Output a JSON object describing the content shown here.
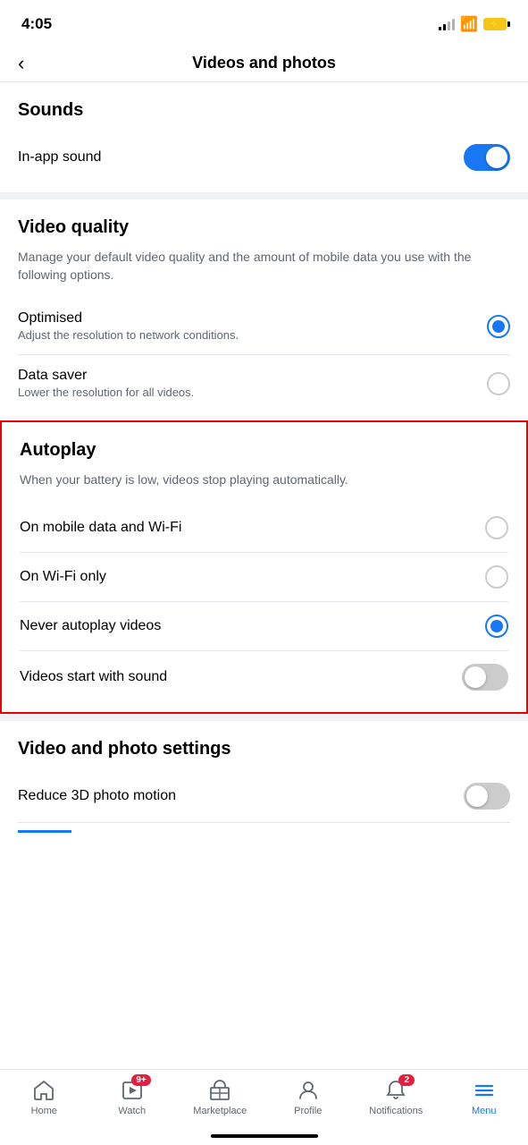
{
  "statusBar": {
    "time": "4:05"
  },
  "header": {
    "backLabel": "‹",
    "title": "Videos and photos"
  },
  "sounds": {
    "sectionTitle": "Sounds",
    "inAppSound": {
      "label": "In-app sound",
      "enabled": true
    }
  },
  "videoQuality": {
    "sectionTitle": "Video quality",
    "description": "Manage your default video quality and the amount of mobile data you use with the following options.",
    "options": [
      {
        "label": "Optimised",
        "sublabel": "Adjust the resolution to network conditions.",
        "selected": true
      },
      {
        "label": "Data saver",
        "sublabel": "Lower the resolution for all videos.",
        "selected": false
      }
    ]
  },
  "autoplay": {
    "sectionTitle": "Autoplay",
    "description": "When your battery is low, videos stop playing automatically.",
    "options": [
      {
        "label": "On mobile data and Wi-Fi",
        "selected": false
      },
      {
        "label": "On Wi-Fi only",
        "selected": false
      },
      {
        "label": "Never autoplay videos",
        "selected": true
      }
    ],
    "videosStartWithSound": {
      "label": "Videos start with sound",
      "enabled": false
    }
  },
  "videoPhotoSettings": {
    "sectionTitle": "Video and photo settings",
    "reduce3dPhotoMotion": {
      "label": "Reduce 3D photo motion",
      "enabled": false
    }
  },
  "bottomNav": {
    "items": [
      {
        "id": "home",
        "label": "Home",
        "badge": null,
        "active": false
      },
      {
        "id": "watch",
        "label": "Watch",
        "badge": "9+",
        "active": false
      },
      {
        "id": "marketplace",
        "label": "Marketplace",
        "badge": null,
        "active": false
      },
      {
        "id": "profile",
        "label": "Profile",
        "badge": null,
        "active": false
      },
      {
        "id": "notifications",
        "label": "Notifications",
        "badge": "2",
        "active": false
      },
      {
        "id": "menu",
        "label": "Menu",
        "badge": null,
        "active": true
      }
    ]
  }
}
